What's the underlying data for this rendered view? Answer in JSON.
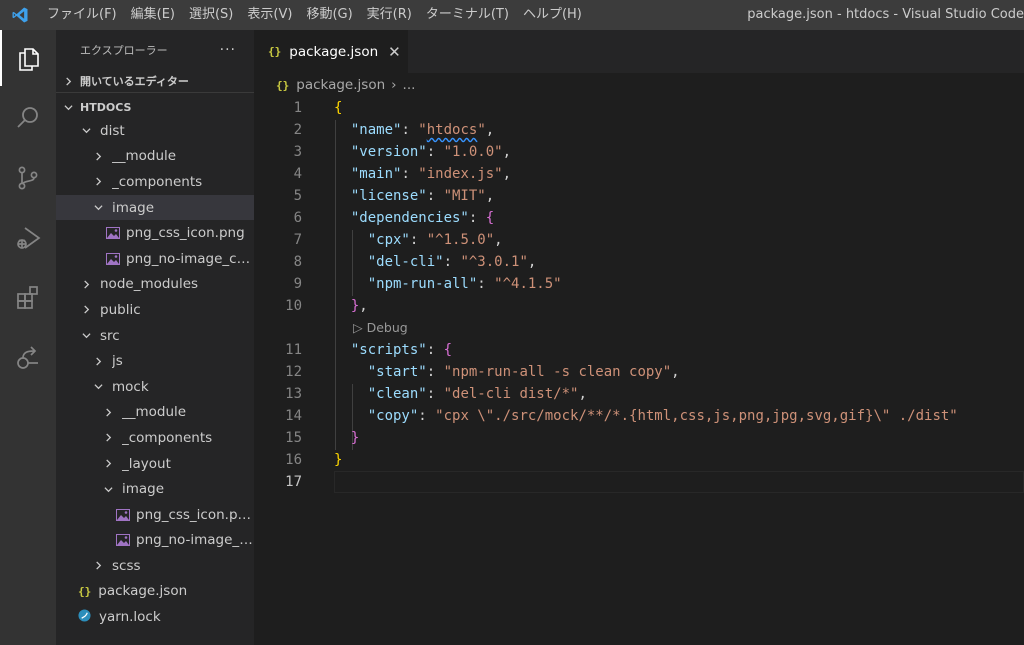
{
  "titlebar": {
    "menu": [
      "ファイル(F)",
      "編集(E)",
      "選択(S)",
      "表示(V)",
      "移動(G)",
      "実行(R)",
      "ターミナル(T)",
      "ヘルプ(H)"
    ],
    "window_title": "package.json - htdocs - Visual Studio Code"
  },
  "activity_bar": {
    "items": [
      "explorer-icon",
      "search-icon",
      "source-control-icon",
      "run-debug-icon",
      "extensions-icon",
      "remote-icon"
    ],
    "active": "explorer-icon"
  },
  "sidebar": {
    "title": "エクスプローラー",
    "more": "···",
    "open_editors": "開いているエディター",
    "folder": "HTDOCS",
    "tree": [
      {
        "label": "dist",
        "type": "folder",
        "expanded": true
      },
      {
        "label": "__module",
        "type": "folder",
        "expanded": false
      },
      {
        "label": "_components",
        "type": "folder",
        "expanded": false
      },
      {
        "label": "image",
        "type": "folder",
        "expanded": true,
        "selected": true
      },
      {
        "label": "png_css_icon.png",
        "type": "image"
      },
      {
        "label": "png_no-image_css....",
        "type": "image"
      },
      {
        "label": "node_modules",
        "type": "folder",
        "expanded": false
      },
      {
        "label": "public",
        "type": "folder",
        "expanded": false
      },
      {
        "label": "src",
        "type": "folder",
        "expanded": true
      },
      {
        "label": "js",
        "type": "folder",
        "expanded": false
      },
      {
        "label": "mock",
        "type": "folder",
        "expanded": true
      },
      {
        "label": "__module",
        "type": "folder",
        "expanded": false
      },
      {
        "label": "_components",
        "type": "folder",
        "expanded": false
      },
      {
        "label": "_layout",
        "type": "folder",
        "expanded": false
      },
      {
        "label": "image",
        "type": "folder",
        "expanded": true
      },
      {
        "label": "png_css_icon.png",
        "type": "image"
      },
      {
        "label": "png_no-image_cs...",
        "type": "image"
      },
      {
        "label": "scss",
        "type": "folder",
        "expanded": false
      },
      {
        "label": "package.json",
        "type": "json"
      },
      {
        "label": "yarn.lock",
        "type": "yarn"
      }
    ]
  },
  "editor": {
    "tab": {
      "label": "package.json",
      "icon": "{}",
      "close": "✕"
    },
    "breadcrumb": {
      "file": "package.json",
      "separator": "›",
      "more": "..."
    },
    "codelens": "▷ Debug",
    "line_numbers": [
      "1",
      "2",
      "3",
      "4",
      "5",
      "6",
      "7",
      "8",
      "9",
      "10",
      "11",
      "12",
      "13",
      "14",
      "15",
      "16",
      "17"
    ],
    "current_line": "17",
    "code": {
      "line1": "{",
      "name_key": "\"name\"",
      "name_val_q1": "\"",
      "name_val": "htdocs",
      "name_val_q2": "\"",
      "version_key": "\"version\"",
      "version_val": "\"1.0.0\"",
      "main_key": "\"main\"",
      "main_val": "\"index.js\"",
      "license_key": "\"license\"",
      "license_val": "\"MIT\"",
      "deps_key": "\"dependencies\"",
      "deps_open": "{",
      "cpx_key": "\"cpx\"",
      "cpx_val": "\"^1.5.0\"",
      "delcli_key": "\"del-cli\"",
      "delcli_val": "\"^3.0.1\"",
      "npmrun_key": "\"npm-run-all\"",
      "npmrun_val": "\"^4.1.5\"",
      "deps_close": "}",
      "scripts_key": "\"scripts\"",
      "scripts_open": "{",
      "start_key": "\"start\"",
      "start_val": "\"npm-run-all -s clean copy\"",
      "clean_key": "\"clean\"",
      "clean_val": "\"del-cli dist/*\"",
      "copy_key": "\"copy\"",
      "copy_val": "\"cpx \\\"./src/mock/**/*.{html,css,js,png,jpg,svg,gif}\\\" ./dist\"",
      "scripts_close": "}",
      "line16": "}",
      "colon": ": ",
      "comma": ","
    }
  },
  "colors": {
    "key": "#9cdcfe",
    "string": "#ce9178",
    "bracket_1": "#ffd700",
    "bracket_2": "#da70d6",
    "bracket_3": "#179fff",
    "json_icon": "#cbcb41",
    "image_icon": "#a074c4",
    "activity_bar": "#333333",
    "sidebar": "#252526",
    "editor": "#1e1e1e",
    "titlebar": "#3c3c3c"
  }
}
